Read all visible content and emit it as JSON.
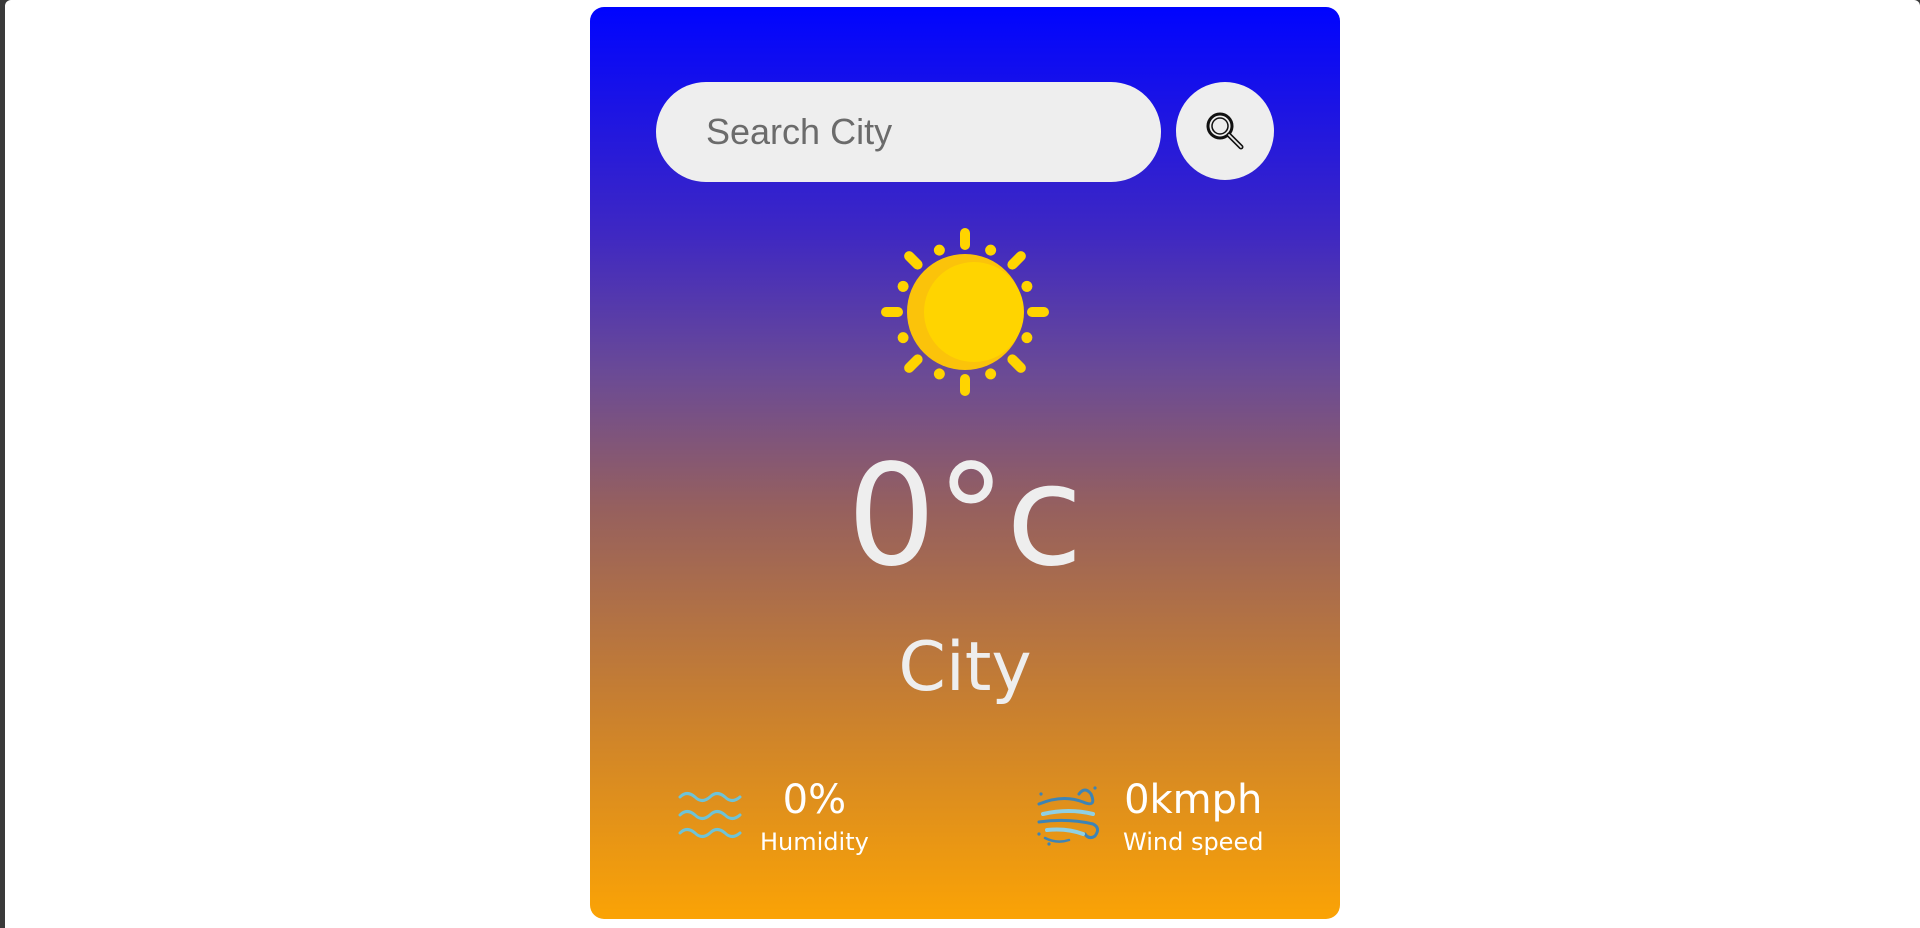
{
  "search": {
    "placeholder": "Search City",
    "button_icon": "search-icon"
  },
  "weather": {
    "icon": "sun-icon",
    "temperature": "0°c",
    "city": "City"
  },
  "details": {
    "humidity": {
      "icon": "humidity-waves-icon",
      "value": "0%",
      "label": "Humidity"
    },
    "wind": {
      "icon": "wind-icon",
      "value": "0kmph",
      "label": "Wind speed"
    }
  },
  "colors": {
    "gradient_top": "#0004ff",
    "gradient_bottom": "#fba305",
    "sun": "#ffd400",
    "text": "#eeeeee"
  }
}
